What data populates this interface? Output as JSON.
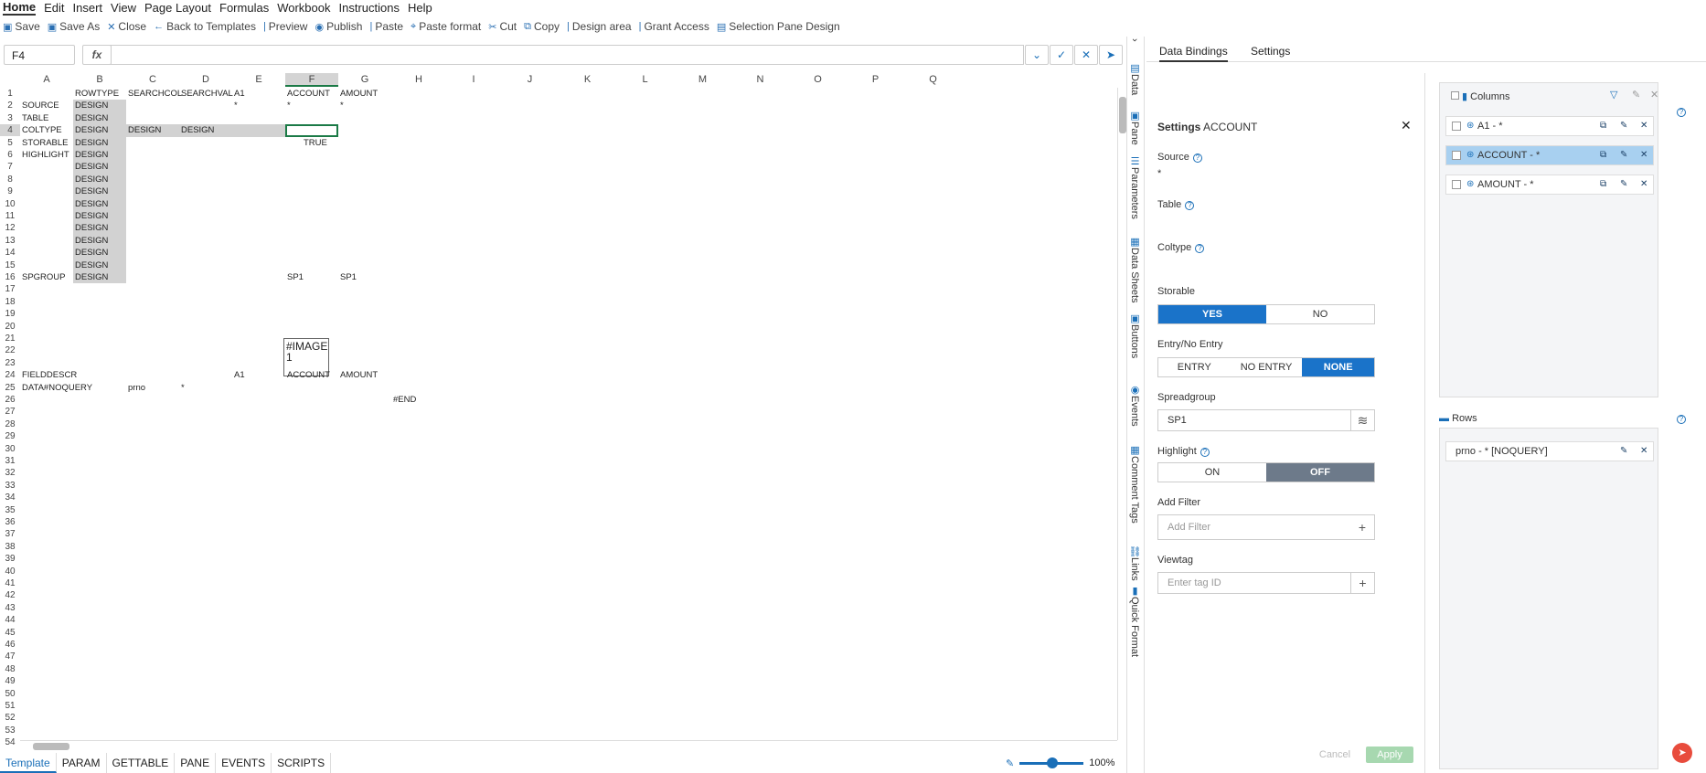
{
  "menu": [
    "Home",
    "Edit",
    "Insert",
    "View",
    "Page Layout",
    "Formulas",
    "Workbook",
    "Instructions",
    "Help"
  ],
  "toolbar": [
    {
      "icon": "save-icon",
      "label": "Save"
    },
    {
      "icon": "save-as-icon",
      "label": "Save As"
    },
    {
      "icon": "close-icon",
      "label": "Close"
    },
    {
      "icon": "arrow-left-icon",
      "label": "Back to Templates"
    },
    {
      "icon": "preview-icon",
      "label": "Preview"
    },
    {
      "icon": "publish-icon",
      "label": "Publish"
    },
    {
      "icon": "paste-icon",
      "label": "Paste"
    },
    {
      "icon": "paste-format-icon",
      "label": "Paste format"
    },
    {
      "icon": "cut-icon",
      "label": "Cut"
    },
    {
      "icon": "copy-icon",
      "label": "Copy"
    },
    {
      "icon": "design-area-icon",
      "label": "Design area"
    },
    {
      "icon": "key-icon",
      "label": "Grant Access"
    },
    {
      "icon": "pane-icon",
      "label": "Selection Pane Design"
    }
  ],
  "formula": {
    "namebox": "F4",
    "fx": "fx",
    "value": ""
  },
  "columns": [
    "A",
    "B",
    "C",
    "D",
    "E",
    "F",
    "G",
    "H",
    "I",
    "J",
    "K",
    "L",
    "M",
    "N",
    "O",
    "P",
    "Q"
  ],
  "selected_col": "F",
  "selected_row": 4,
  "rows_count": 54,
  "cells": [
    {
      "r": 1,
      "c": "B",
      "v": "ROWTYPE"
    },
    {
      "r": 1,
      "c": "C",
      "v": "SEARCHCOL"
    },
    {
      "r": 1,
      "c": "D",
      "v": "SEARCHVAL"
    },
    {
      "r": 1,
      "c": "E",
      "v": "A1"
    },
    {
      "r": 1,
      "c": "F",
      "v": "ACCOUNT"
    },
    {
      "r": 1,
      "c": "G",
      "v": "AMOUNT"
    },
    {
      "r": 2,
      "c": "A",
      "v": "SOURCE"
    },
    {
      "r": 2,
      "c": "B",
      "v": "DESIGN"
    },
    {
      "r": 2,
      "c": "E",
      "v": "*"
    },
    {
      "r": 2,
      "c": "F",
      "v": "*"
    },
    {
      "r": 2,
      "c": "G",
      "v": "*"
    },
    {
      "r": 3,
      "c": "A",
      "v": "TABLE"
    },
    {
      "r": 3,
      "c": "B",
      "v": "DESIGN"
    },
    {
      "r": 4,
      "c": "A",
      "v": "COLTYPE"
    },
    {
      "r": 4,
      "c": "B",
      "v": "DESIGN"
    },
    {
      "r": 4,
      "c": "C",
      "v": "DESIGN"
    },
    {
      "r": 4,
      "c": "D",
      "v": "DESIGN"
    },
    {
      "r": 5,
      "c": "A",
      "v": "STORABLE"
    },
    {
      "r": 5,
      "c": "B",
      "v": "DESIGN"
    },
    {
      "r": 5,
      "c": "F",
      "v": "TRUE"
    },
    {
      "r": 6,
      "c": "A",
      "v": "HIGHLIGHT"
    },
    {
      "r": 6,
      "c": "B",
      "v": "DESIGN"
    },
    {
      "r": 7,
      "c": "B",
      "v": "DESIGN"
    },
    {
      "r": 8,
      "c": "B",
      "v": "DESIGN"
    },
    {
      "r": 9,
      "c": "B",
      "v": "DESIGN"
    },
    {
      "r": 10,
      "c": "B",
      "v": "DESIGN"
    },
    {
      "r": 11,
      "c": "B",
      "v": "DESIGN"
    },
    {
      "r": 12,
      "c": "B",
      "v": "DESIGN"
    },
    {
      "r": 13,
      "c": "B",
      "v": "DESIGN"
    },
    {
      "r": 14,
      "c": "B",
      "v": "DESIGN"
    },
    {
      "r": 15,
      "c": "B",
      "v": "DESIGN"
    },
    {
      "r": 16,
      "c": "A",
      "v": "SPGROUP"
    },
    {
      "r": 16,
      "c": "B",
      "v": "DESIGN"
    },
    {
      "r": 16,
      "c": "F",
      "v": "SP1"
    },
    {
      "r": 16,
      "c": "G",
      "v": "SP1"
    },
    {
      "r": 24,
      "c": "A",
      "v": "FIELDDESCR"
    },
    {
      "r": 24,
      "c": "E",
      "v": "A1"
    },
    {
      "r": 24,
      "c": "F",
      "v": "ACCOUNT"
    },
    {
      "r": 24,
      "c": "G",
      "v": "AMOUNT"
    },
    {
      "r": 25,
      "c": "A",
      "v": "DATA#NOQUERY"
    },
    {
      "r": 25,
      "c": "C",
      "v": "prno"
    },
    {
      "r": 25,
      "c": "D",
      "v": "*"
    },
    {
      "r": 26,
      "c": "H",
      "v": "#END"
    }
  ],
  "image_label": "#IMAGE 1",
  "sheet_tabs": [
    "Template",
    "PARAM",
    "GETTABLE",
    "PANE",
    "EVENTS",
    "SCRIPTS"
  ],
  "zoom": "100%",
  "side_tabs": [
    "Data",
    "Pane",
    "Parameters",
    "Data Sheets",
    "Buttons",
    "Events",
    "Comment Tags",
    "Links",
    "Quick Format"
  ],
  "panel": {
    "tabs": [
      "Data Bindings",
      "Settings"
    ],
    "settings_title": "Settings",
    "settings_subject": "ACCOUNT",
    "source_label": "Source",
    "source_value": "*",
    "table_label": "Table",
    "coltype_label": "Coltype",
    "storable_label": "Storable",
    "storable_opts": [
      "YES",
      "NO"
    ],
    "entry_label": "Entry/No Entry",
    "entry_opts": [
      "ENTRY",
      "NO ENTRY",
      "NONE"
    ],
    "spreadgroup_label": "Spreadgroup",
    "spreadgroup_value": "SP1",
    "highlight_label": "Highlight",
    "highlight_opts": [
      "ON",
      "OFF"
    ],
    "filter_label": "Add Filter",
    "filter_placeholder": "Add Filter",
    "viewtag_label": "Viewtag",
    "viewtag_placeholder": "Enter tag ID",
    "cancel": "Cancel",
    "apply": "Apply"
  },
  "columns_box": {
    "title": "Columns",
    "items": [
      "A1 - *",
      "ACCOUNT - *",
      "AMOUNT - *"
    ]
  },
  "rows_box": {
    "title": "Rows",
    "items": [
      "prno - * [NOQUERY]"
    ]
  }
}
